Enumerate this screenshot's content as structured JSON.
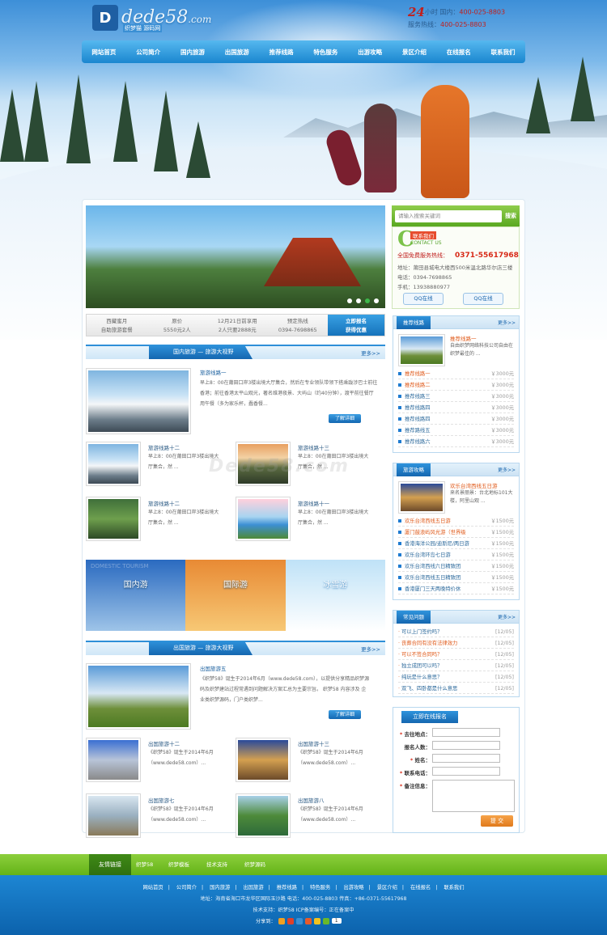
{
  "header": {
    "logo_text": "dede58",
    "logo_suffix": ".com",
    "logo_mark": "D",
    "logo_sub": "织梦猫 源码网",
    "hotline_num": "24",
    "hotline_unit": "小时",
    "domestic_label": "国内：",
    "domestic_phone": "400-025-8803",
    "service_label": "服务热线：",
    "service_phone": "400-025-8803"
  },
  "nav": [
    "网站首页",
    "公司简介",
    "国内旅游",
    "出国旅游",
    "推荐线路",
    "特色服务",
    "出游攻略",
    "景区介绍",
    "在线报名",
    "联系我们"
  ],
  "infobar": {
    "c1a": "西藏蜜月",
    "c1b": "自助旅游套餐",
    "c2a": "原价",
    "c2b": "5550元2人",
    "c3a": "12月21日前享用",
    "c3b": "2人只要2888元",
    "c4a": "预定热线",
    "c4b": "0394-7698865",
    "cta_a": "立即报名",
    "cta_b": "获得优惠"
  },
  "search": {
    "placeholder": "请输入搜索关键词",
    "button": "搜索"
  },
  "contact": {
    "letter": "C",
    "tag": "联系我们",
    "en": "CONTACT US",
    "hot_label": "全国免费服务热线：",
    "hot_num": "0371-55617968",
    "address": "地址：莆田县城电大楼西500米温北路华尔店三楼",
    "phone": "电话：0394-7698865",
    "mobile": "手机：13938880977",
    "qq1": "QQ在线",
    "qq2": "QQ在线"
  },
  "domestic": {
    "tab": "国内旅游",
    "subtab": "旅游大视野",
    "more": "更多>>",
    "featured_title": "旅游线路一",
    "featured_text": "早上8：00在莆田口岸3楼出境大厅集合，然后在专业领队带领下搭乘跋涉巴士前往香港；前往香港太平山观光，著名维港夜景、大屿山（约40分钟），渡平前往餐厅用午餐（多为家乐杯，蠢香餐...",
    "detail": "了解详细",
    "items": [
      {
        "title": "旅游线路十二",
        "text1": "早上8：00在莆田口岸3楼出境大",
        "text2": "厅集合，然 ..."
      },
      {
        "title": "旅游线路十三",
        "text1": "早上8：00在莆田口岸3楼出境大",
        "text2": "厅集合，然 ..."
      },
      {
        "title": "旅游线路十二",
        "text1": "早上8：00在莆田口岸3楼出境大",
        "text2": "厅集合，然 ..."
      },
      {
        "title": "旅游线路十一",
        "text1": "早上8：00在莆田口岸3楼出境大",
        "text2": "厅集合，然 ..."
      }
    ]
  },
  "banner": {
    "domestic": "国内游",
    "international": "国际游",
    "ice": "冰雪游",
    "en": "DOMESTIC TOURISM"
  },
  "abroad": {
    "tab": "出国旅游",
    "subtab": "旅游大视野",
    "more": "更多>>",
    "featured_title": "出国旅游五",
    "featured_text": "《织梦58》诞生于2014年6月（www.dede58.com），以提供分享精品织梦源码及织梦建站过程常遇到问题解决方案汇总为主要宗旨。 织梦58 内容涉及 企业类织梦源码，门户类织梦...",
    "detail": "了解详细",
    "items": [
      {
        "title": "出国旅游十二",
        "text1": "《织梦58》诞生于2014年6月",
        "text2": "（www.dede58.com）..."
      },
      {
        "title": "出国旅游十三",
        "text1": "《织梦58》诞生于2014年6月",
        "text2": "（www.dede58.com）..."
      },
      {
        "title": "出国旅游七",
        "text1": "《织梦58》诞生于2014年6月",
        "text2": "（www.dede58.com）..."
      },
      {
        "title": "出国旅游八",
        "text1": "《织梦58》诞生于2014年6月",
        "text2": "（www.dede58.com）..."
      }
    ]
  },
  "recommend": {
    "title": "推荐线路",
    "more": "更多>>",
    "feat_title": "推荐线路一",
    "feat_text": "自由织梦网络科技公司自由在织梦最佳的 ...",
    "rows": [
      {
        "name": "推荐线路一",
        "price": "￥3000元",
        "hl": true
      },
      {
        "name": "推荐线路二",
        "price": "￥3000元",
        "hl": true
      },
      {
        "name": "推荐线路三",
        "price": "￥3000元",
        "hl": false
      },
      {
        "name": "推荐线路四",
        "price": "￥3000元",
        "hl": false
      },
      {
        "name": "推荐线路四",
        "price": "￥3000元",
        "hl": false
      },
      {
        "name": "推荐路线五",
        "price": "￥3000元",
        "hl": false
      },
      {
        "name": "推荐线路六",
        "price": "￥3000元",
        "hl": false
      }
    ]
  },
  "guide": {
    "title": "旅游攻略",
    "more": "更多>>",
    "feat_title": "欢乐台湾西线五日游",
    "feat_text": "来名景丽景：台北地标101大楼，阿里山观 ...",
    "rows": [
      {
        "name": "欢乐台湾西线五日游",
        "price": "￥1500元",
        "hl": true
      },
      {
        "name": "厦门鼓浪屿风光游（世界级",
        "price": "￥1500元",
        "hl": true
      },
      {
        "name": "香港海洋公园/迪斯尼/两日游",
        "price": "￥1500元",
        "hl": false
      },
      {
        "name": "欢乐台湾环岛七日游",
        "price": "￥1500元",
        "hl": false
      },
      {
        "name": "欢乐台湾西线六日精致团",
        "price": "￥1500元",
        "hl": false
      },
      {
        "name": "欢乐台湾西线五日精致团",
        "price": "￥1500元",
        "hl": false
      },
      {
        "name": "香港厦门三天两晚特价休",
        "price": "￥1500元",
        "hl": false
      }
    ]
  },
  "faq": {
    "title": "常见问题",
    "more": "更多>>",
    "rows": [
      {
        "name": "可以上门签约吗？",
        "date": "[12/05]",
        "hl": false
      },
      {
        "name": "丧葬合同有没有法律效力",
        "date": "[12/05]",
        "hl": true
      },
      {
        "name": "可以不签合同吗？",
        "date": "[12/05]",
        "hl": true
      },
      {
        "name": "独立成团可以吗？",
        "date": "[12/05]",
        "hl": false
      },
      {
        "name": "纯玩是什么意思？",
        "date": "[12/05]",
        "hl": false
      },
      {
        "name": "双飞、四卧都是什么意思",
        "date": "[12/05]",
        "hl": false
      }
    ]
  },
  "signup": {
    "title": "立即在线报名",
    "dest": "去往地点：",
    "count": "报名人数：",
    "name": "姓名：",
    "phone": "联系电话：",
    "note": "备注信息：",
    "submit": "提 交"
  },
  "friend": {
    "title": "友情链接",
    "links": [
      "织梦58",
      "织梦模板",
      "技术支持",
      "织梦源码"
    ]
  },
  "footer": {
    "links": [
      "网站首页",
      "公司简介",
      "国内旅游",
      "出国旅游",
      "推荐线路",
      "特色服务",
      "出游攻略",
      "景区介绍",
      "在线报名",
      "联系我们"
    ],
    "address": "地址：海南省海口市龙华区国际玉沙路  电话：400-025-8803  传真：+86-0371-55617968",
    "support": "技术支持：织梦58  ICP备案编号：正在备案中",
    "share": "分享到：",
    "share_count": "1"
  },
  "watermark": "Dede58.com",
  "colors": {
    "brand": "#1a86cf",
    "green": "#64b318",
    "orange": "#e07a1c",
    "red": "#c0201e"
  }
}
